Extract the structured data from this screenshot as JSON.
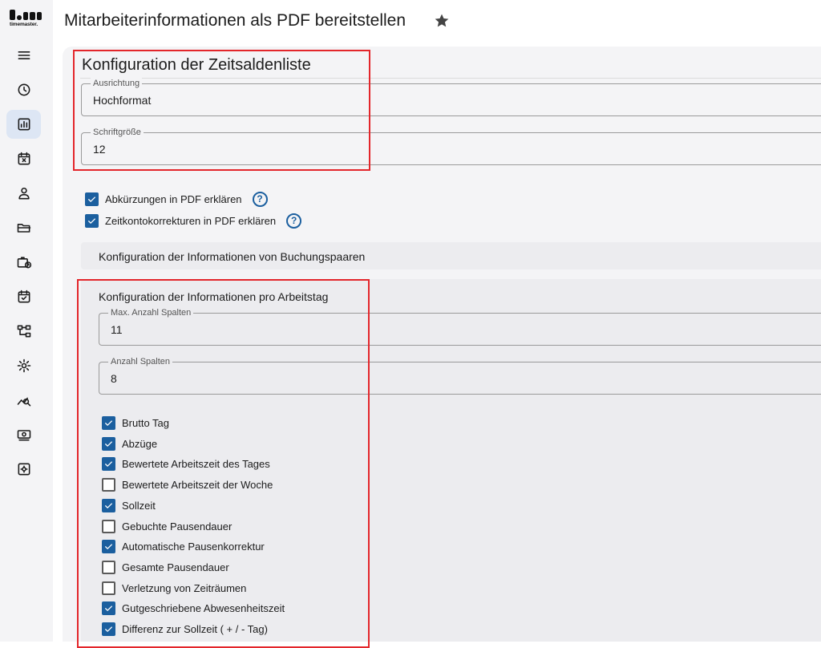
{
  "app": {
    "logo_text": "timemaster."
  },
  "header": {
    "title": "Mitarbeiterinformationen als PDF bereitstellen"
  },
  "sidebar": {
    "items": [
      {
        "icon": "menu-icon"
      },
      {
        "icon": "clock-icon"
      },
      {
        "icon": "report-icon",
        "active": true
      },
      {
        "icon": "calendar-x-icon"
      },
      {
        "icon": "user-icon"
      },
      {
        "icon": "folder-icon"
      },
      {
        "icon": "briefcase-clock-icon"
      },
      {
        "icon": "calendar-check-icon"
      },
      {
        "icon": "hierarchy-icon"
      },
      {
        "icon": "gear-icon"
      },
      {
        "icon": "analytics-icon"
      },
      {
        "icon": "money-icon"
      },
      {
        "icon": "settings-box-icon"
      }
    ]
  },
  "config": {
    "title": "Konfiguration der Zeitsaldenliste",
    "orientation": {
      "label": "Ausrichtung",
      "value": "Hochformat"
    },
    "fontsize": {
      "label": "Schriftgröße",
      "value": "12"
    },
    "options": [
      {
        "label": "Abkürzungen in PDF erklären",
        "checked": true
      },
      {
        "label": "Zeitkontokorrekturen in PDF erklären",
        "checked": true
      }
    ],
    "booking_pairs_label": "Konfiguration der Informationen von Buchungspaaren",
    "workday": {
      "title": "Konfiguration der Informationen pro Arbeitstag",
      "max_columns": {
        "label": "Max. Anzahl Spalten",
        "value": "11"
      },
      "columns": {
        "label": "Anzahl Spalten",
        "value": "8"
      },
      "items": [
        {
          "label": "Brutto Tag",
          "checked": true
        },
        {
          "label": "Abzüge",
          "checked": true
        },
        {
          "label": "Bewertete Arbeitszeit des Tages",
          "checked": true
        },
        {
          "label": "Bewertete Arbeitszeit der Woche",
          "checked": false
        },
        {
          "label": "Sollzeit",
          "checked": true
        },
        {
          "label": "Gebuchte Pausendauer",
          "checked": false
        },
        {
          "label": "Automatische Pausenkorrektur",
          "checked": true
        },
        {
          "label": "Gesamte Pausendauer",
          "checked": false
        },
        {
          "label": "Verletzung von Zeiträumen",
          "checked": false
        },
        {
          "label": "Gutgeschriebene Abwesenheitszeit",
          "checked": true
        },
        {
          "label": "Differenz zur Sollzeit ( + / - Tag)",
          "checked": true
        }
      ]
    }
  },
  "colors": {
    "accent": "#1b5f9f",
    "highlight": "#e3262b",
    "panel": "#f4f4f6"
  }
}
